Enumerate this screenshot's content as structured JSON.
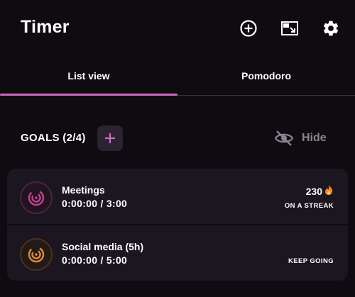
{
  "app": {
    "title": "Timer"
  },
  "toolbar": {
    "icons": [
      "add-circle-icon",
      "picture-in-picture-icon",
      "settings-icon"
    ]
  },
  "tabs": [
    {
      "label": "List view",
      "selected": true
    },
    {
      "label": "Pomodoro",
      "selected": false
    }
  ],
  "goals": {
    "title": "GOALS (2/4)",
    "hide_label": "Hide",
    "items": [
      {
        "name": "Meetings",
        "progress": "0:00:00 / 3:00",
        "streak": "230",
        "status": "ON A STREAK",
        "color": "#c0448f"
      },
      {
        "name": "Social media (5h)",
        "progress": "0:00:00 / 5:00",
        "status": "KEEP GOING",
        "color": "#e08a3c"
      }
    ]
  },
  "colors": {
    "background": "#0f0b10",
    "accent": "#d06ac2",
    "card": "#1b1620",
    "muted": "#8b8490"
  }
}
